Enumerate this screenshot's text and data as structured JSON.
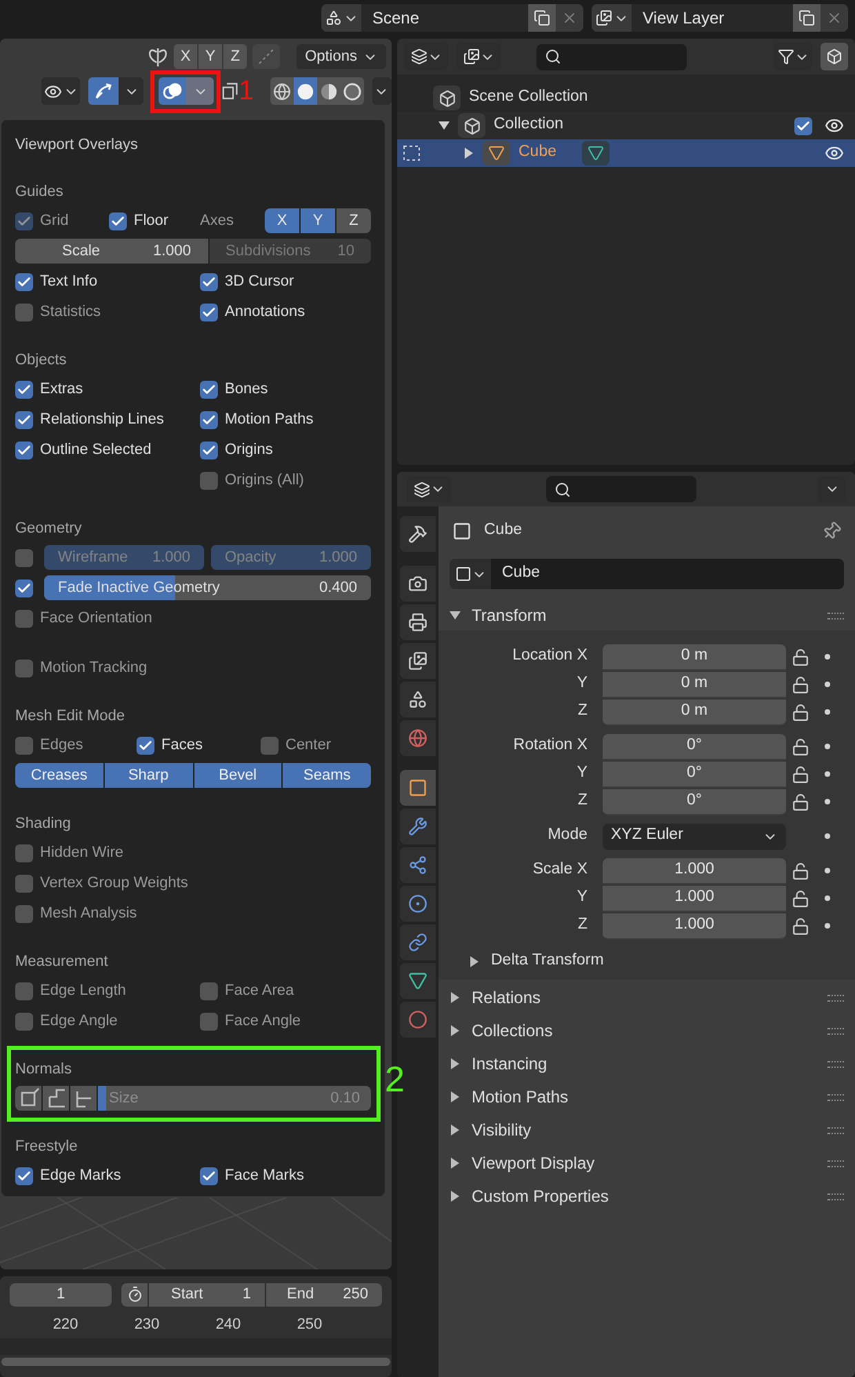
{
  "top_bar": {
    "scene": "Scene",
    "view_layer": "View Layer"
  },
  "viewport": {
    "axes": [
      {
        "label": "X",
        "selected": false
      },
      {
        "label": "Y",
        "selected": false
      },
      {
        "label": "Z",
        "selected": false
      }
    ],
    "options": "Options",
    "gizmos": {
      "on": true
    },
    "overlays_toggle": {
      "on": true
    },
    "shading": [
      {
        "kind": "wireframe",
        "selected": false
      },
      {
        "kind": "solid",
        "selected": true
      },
      {
        "kind": "material",
        "selected": false
      },
      {
        "kind": "rendered",
        "selected": false
      }
    ],
    "annotation": "1"
  },
  "overlays": {
    "title": "Viewport Overlays",
    "sections": [
      {
        "heading": "Guides",
        "rows": [
          {
            "kind": "checks_axes",
            "items": [
              {
                "label": "Grid",
                "checked": true,
                "disabled": true
              },
              {
                "label": "Floor",
                "checked": true,
                "disabled": false
              }
            ],
            "axes_label": "Axes",
            "axes": [
              {
                "label": "X",
                "selected": true
              },
              {
                "label": "Y",
                "selected": true
              },
              {
                "label": "Z",
                "selected": false
              }
            ]
          },
          {
            "kind": "fields",
            "items": [
              {
                "label": "Scale",
                "value": "1.000",
                "disabled": false
              },
              {
                "label": "Subdivisions",
                "value": "10",
                "disabled": true
              }
            ]
          },
          {
            "kind": "checks",
            "items": [
              {
                "label": "Text Info",
                "checked": true
              },
              {
                "label": "3D Cursor",
                "checked": true
              }
            ]
          },
          {
            "kind": "checks",
            "items": [
              {
                "label": "Statistics",
                "checked": false
              },
              {
                "label": "Annotations",
                "checked": true
              }
            ]
          }
        ]
      },
      {
        "heading": "Objects",
        "rows": [
          {
            "kind": "checks",
            "items": [
              {
                "label": "Extras",
                "checked": true
              },
              {
                "label": "Bones",
                "checked": true
              }
            ]
          },
          {
            "kind": "checks",
            "items": [
              {
                "label": "Relationship Lines",
                "checked": true
              },
              {
                "label": "Motion Paths",
                "checked": true
              }
            ]
          },
          {
            "kind": "checks",
            "items": [
              {
                "label": "Outline Selected",
                "checked": true
              },
              {
                "label": "Origins",
                "checked": true
              }
            ]
          },
          {
            "kind": "checks_right",
            "items": [
              {
                "label": "Origins (All)",
                "checked": false
              }
            ]
          }
        ]
      },
      {
        "heading": "Geometry",
        "rows": [
          {
            "kind": "check_sliders",
            "checked": false,
            "items": [
              {
                "label": "Wireframe",
                "value": "1.000",
                "level": 1
              },
              {
                "label": "Opacity",
                "value": "1.000",
                "level": 1
              }
            ]
          },
          {
            "kind": "check_slider",
            "checked": true,
            "label": "Fade Inactive Geometry",
            "value": "0.400",
            "level": 0.4
          },
          {
            "kind": "checks",
            "items": [
              {
                "label": "Face Orientation",
                "checked": false
              }
            ]
          },
          {
            "kind": "checks_spaced",
            "items": [
              {
                "label": "Motion Tracking",
                "checked": false
              }
            ]
          }
        ]
      },
      {
        "heading": "Mesh Edit Mode",
        "rows": [
          {
            "kind": "checks3",
            "items": [
              {
                "label": "Edges",
                "checked": false
              },
              {
                "label": "Faces",
                "checked": true
              },
              {
                "label": "Center",
                "checked": false
              }
            ]
          },
          {
            "kind": "toggles",
            "items": [
              {
                "label": "Creases",
                "selected": true
              },
              {
                "label": "Sharp",
                "selected": true
              },
              {
                "label": "Bevel",
                "selected": true
              },
              {
                "label": "Seams",
                "selected": true
              }
            ]
          }
        ]
      },
      {
        "heading": "Shading",
        "rows": [
          {
            "kind": "checks",
            "items": [
              {
                "label": "Hidden Wire",
                "checked": false
              }
            ]
          },
          {
            "kind": "checks",
            "items": [
              {
                "label": "Vertex Group Weights",
                "checked": false
              }
            ]
          },
          {
            "kind": "checks",
            "items": [
              {
                "label": "Mesh Analysis",
                "checked": false
              }
            ]
          }
        ]
      },
      {
        "heading": "Measurement",
        "rows": [
          {
            "kind": "checks",
            "items": [
              {
                "label": "Edge Length",
                "checked": false
              },
              {
                "label": "Face Area",
                "checked": false
              }
            ]
          },
          {
            "kind": "checks",
            "items": [
              {
                "label": "Edge Angle",
                "checked": false
              },
              {
                "label": "Face Angle",
                "checked": false
              }
            ]
          }
        ]
      },
      {
        "heading": "Normals",
        "annotation": "2",
        "rows": [
          {
            "kind": "normals",
            "buttons": [
              {
                "kind": "vertex",
                "selected": false
              },
              {
                "kind": "split",
                "selected": false
              },
              {
                "kind": "face",
                "selected": false
              }
            ],
            "label": "Size",
            "value": "0.10",
            "level": 0.03
          }
        ]
      },
      {
        "heading": "Freestyle",
        "rows": [
          {
            "kind": "checks",
            "items": [
              {
                "label": "Edge Marks",
                "checked": true
              },
              {
                "label": "Face Marks",
                "checked": true
              }
            ]
          }
        ]
      }
    ]
  },
  "timeline": {
    "frame": "1",
    "start_label": "Start",
    "start": "1",
    "end_label": "End",
    "end": "250",
    "ruler": [
      "220",
      "230",
      "240",
      "250"
    ]
  },
  "outliner": {
    "tree": [
      {
        "label": "Scene Collection",
        "kind": "scene_collection",
        "selected": false,
        "children": [
          {
            "label": "Collection",
            "kind": "collection",
            "selected": false,
            "expanded": true,
            "checked": true,
            "visible": true,
            "children": [
              {
                "label": "Cube",
                "kind": "mesh_object",
                "selected": true,
                "expanded": false,
                "visible": true
              }
            ]
          }
        ]
      }
    ]
  },
  "properties": {
    "tabs": [
      {
        "kind": "tool",
        "selected": false
      },
      {
        "kind": "render",
        "selected": false
      },
      {
        "kind": "output",
        "selected": false
      },
      {
        "kind": "view_layer",
        "selected": false
      },
      {
        "kind": "scene",
        "selected": false
      },
      {
        "kind": "world",
        "selected": false
      },
      {
        "kind": "object",
        "selected": true
      },
      {
        "kind": "modifiers",
        "selected": false
      },
      {
        "kind": "particles",
        "selected": false
      },
      {
        "kind": "physics",
        "selected": false
      },
      {
        "kind": "constraints",
        "selected": false
      },
      {
        "kind": "data",
        "selected": false
      },
      {
        "kind": "material",
        "selected": false
      }
    ],
    "object_name": "Cube",
    "datablock": "Cube",
    "transform": {
      "title": "Transform",
      "expanded": true,
      "groups": [
        {
          "kind": "vector",
          "rows": [
            {
              "label": "Location X",
              "value": "0 m"
            },
            {
              "label": "Y",
              "value": "0 m"
            },
            {
              "label": "Z",
              "value": "0 m"
            }
          ]
        },
        {
          "kind": "vector",
          "rows": [
            {
              "label": "Rotation X",
              "value": "0°"
            },
            {
              "label": "Y",
              "value": "0°"
            },
            {
              "label": "Z",
              "value": "0°"
            }
          ]
        },
        {
          "kind": "dropdown",
          "label": "Mode",
          "value": "XYZ Euler"
        },
        {
          "kind": "vector",
          "rows": [
            {
              "label": "Scale X",
              "value": "1.000"
            },
            {
              "label": "Y",
              "value": "1.000"
            },
            {
              "label": "Z",
              "value": "1.000"
            }
          ]
        }
      ],
      "subpanel": {
        "title": "Delta Transform",
        "expanded": false
      }
    },
    "panels": [
      {
        "title": "Relations",
        "expanded": false
      },
      {
        "title": "Collections",
        "expanded": false
      },
      {
        "title": "Instancing",
        "expanded": false
      },
      {
        "title": "Motion Paths",
        "expanded": false
      },
      {
        "title": "Visibility",
        "expanded": false
      },
      {
        "title": "Viewport Display",
        "expanded": false
      },
      {
        "title": "Custom Properties",
        "expanded": false
      }
    ]
  }
}
